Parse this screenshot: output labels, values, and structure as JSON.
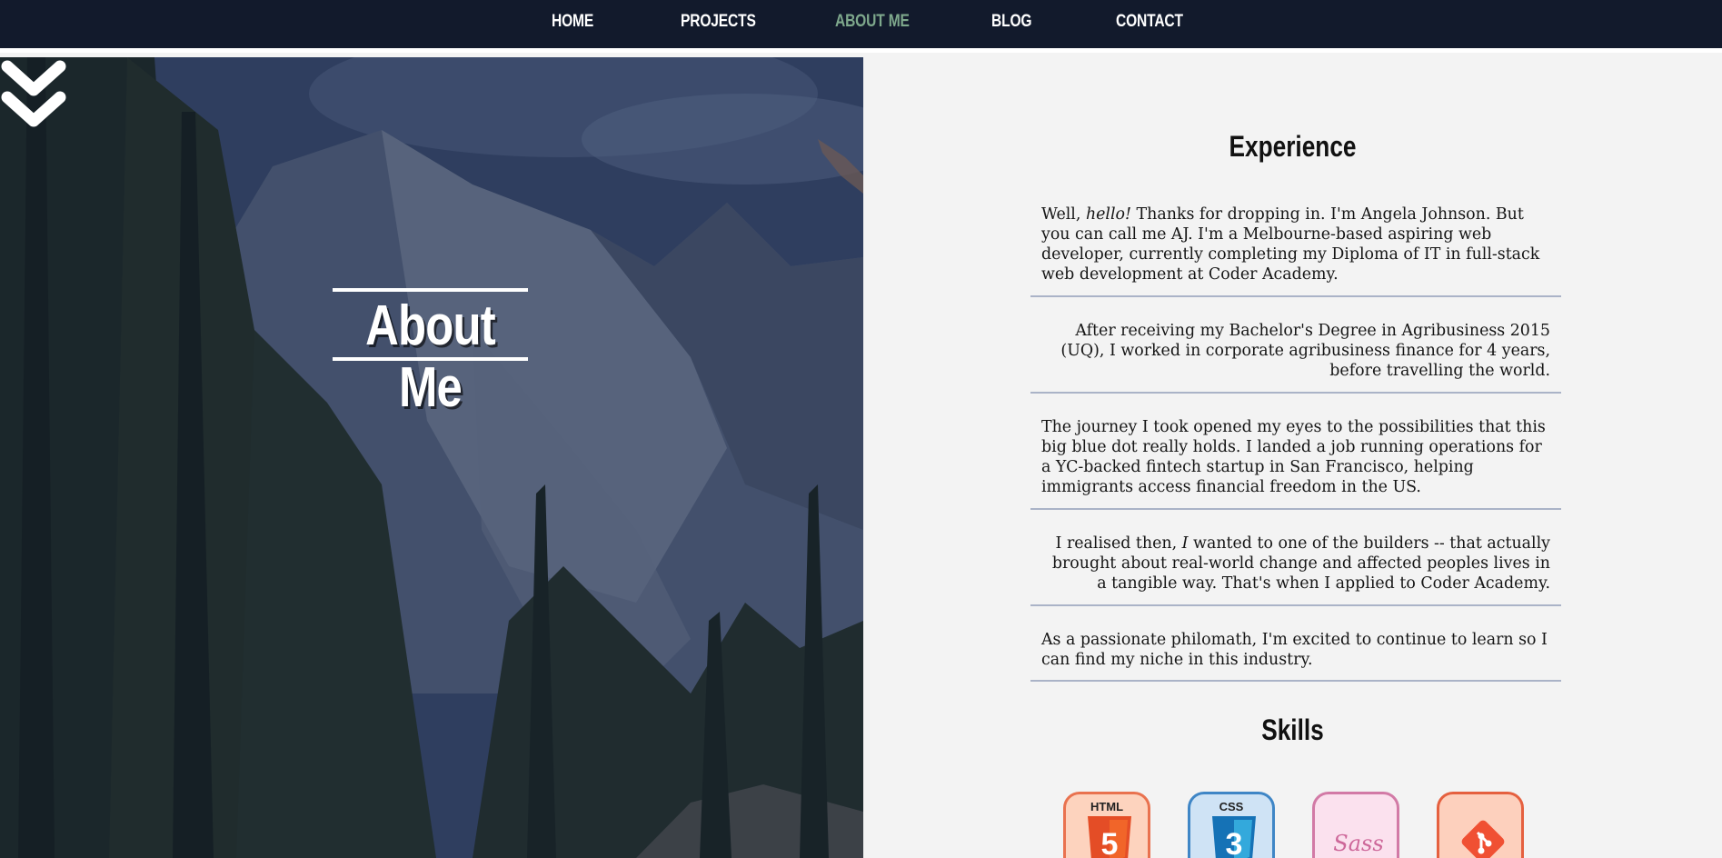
{
  "nav": {
    "items": [
      {
        "label": "HOME",
        "active": false
      },
      {
        "label": "PROJECTS",
        "active": false
      },
      {
        "label": "ABOUT ME",
        "active": true
      },
      {
        "label": "BLOG",
        "active": false
      },
      {
        "label": "CONTACT",
        "active": false
      }
    ],
    "active_color": "#7ea88c"
  },
  "hero": {
    "title": "About Me",
    "scroll_icon": "double-chevron-down-icon"
  },
  "experience": {
    "heading": "Experience",
    "paragraphs": [
      {
        "before": "Well, ",
        "em": "hello!",
        "after": " Thanks for dropping in. I'm Angela Johnson. But you can call me AJ. I'm a Melbourne-based aspiring web developer, currently completing my Diploma of IT in full-stack web development at Coder Academy."
      },
      {
        "text": "After receiving my Bachelor's Degree in Agribusiness 2015 (UQ), I worked in corporate agribusiness finance for 4 years, before travelling the world."
      },
      {
        "text": "The journey I took opened my eyes to the possibilities that this big blue dot really holds. I landed a job running operations for a YC-backed fintech startup in San Francisco, helping immigrants access financial freedom in the US."
      },
      {
        "before": "I realised then, ",
        "em": "I",
        "after": " wanted to one of the builders -- that actually brought about real-world change and affected peoples lives in a tangible way. That's when I applied to Coder Academy."
      },
      {
        "text": "As a passionate philomath, I'm excited to continue to learn so I can find my niche in this industry."
      }
    ]
  },
  "skills": {
    "heading": "Skills",
    "items": [
      {
        "name": "html5-icon",
        "tag": "HTML",
        "glyph": "5",
        "color": "#e44d26",
        "bg": "#fdd3be"
      },
      {
        "name": "css3-icon",
        "tag": "CSS",
        "glyph": "3",
        "color": "#1572b6",
        "bg": "#cfe3f5"
      },
      {
        "name": "sass-icon",
        "tag": "",
        "glyph": "Sass",
        "color": "#cd6799",
        "bg": "#fbe1ee"
      },
      {
        "name": "git-icon",
        "tag": "",
        "glyph": "",
        "color": "#f05033",
        "bg": "#fdd0bd"
      }
    ]
  }
}
